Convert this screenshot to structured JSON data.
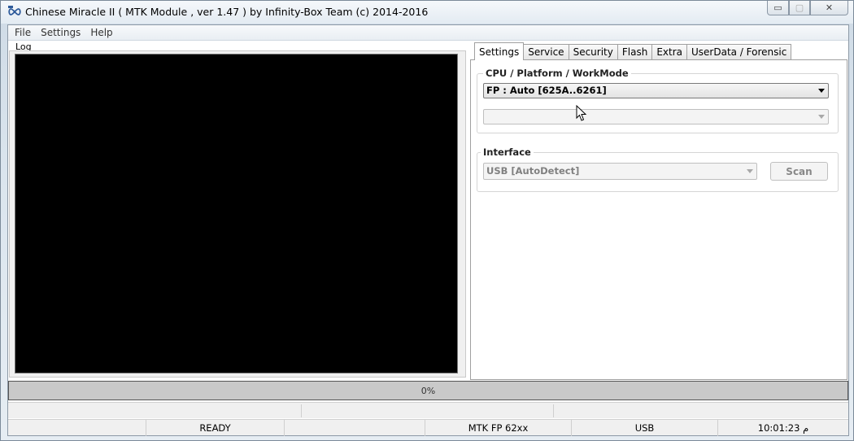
{
  "window": {
    "title": "Chinese Miracle II ( MTK Module , ver 1.47 ) by Infinity-Box Team (c) 2014-2016",
    "controls": {
      "minimize": "▭",
      "maximize": "▢",
      "close": "✕"
    }
  },
  "menu": [
    "File",
    "Settings",
    "Help"
  ],
  "log": {
    "label": "Log"
  },
  "tabs": [
    "Settings",
    "Service",
    "Security",
    "Flash",
    "Extra",
    "UserData / Forensic"
  ],
  "settings": {
    "cpu_group_title": "CPU / Platform / WorkMode",
    "platform_value": "FP : Auto [625A..6261]",
    "workmode_value": "",
    "interface_group_title": "Interface",
    "interface_value": "USB [AutoDetect]",
    "scan_button": "Scan"
  },
  "progress": {
    "text": "0%",
    "value": 0
  },
  "status": {
    "cells": [
      "",
      "READY",
      "",
      "MTK FP 62xx",
      "USB",
      "10:01:23 م"
    ]
  }
}
